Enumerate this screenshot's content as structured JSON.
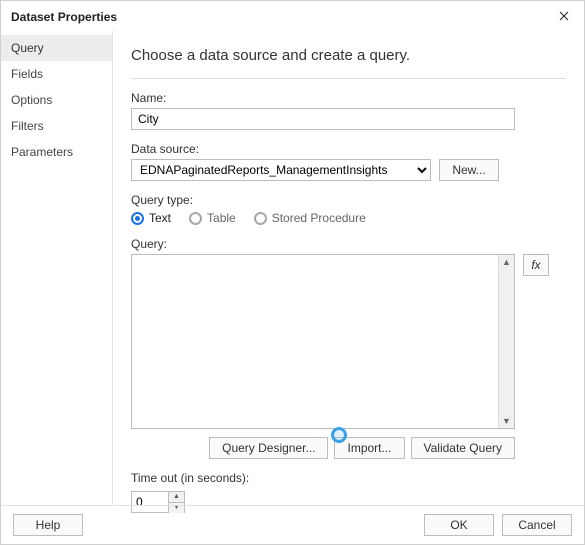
{
  "dialog": {
    "title": "Dataset Properties",
    "close_icon": "close-icon"
  },
  "sidebar": {
    "items": [
      {
        "label": "Query",
        "active": true
      },
      {
        "label": "Fields",
        "active": false
      },
      {
        "label": "Options",
        "active": false
      },
      {
        "label": "Filters",
        "active": false
      },
      {
        "label": "Parameters",
        "active": false
      }
    ]
  },
  "content": {
    "heading": "Choose a data source and create a query.",
    "name_label": "Name:",
    "name_value": "City",
    "datasource_label": "Data source:",
    "datasource_value": "EDNAPaginatedReports_ManagementInsights",
    "new_button": "New...",
    "querytype_label": "Query type:",
    "querytype_options": [
      {
        "label": "Text",
        "checked": true
      },
      {
        "label": "Table",
        "checked": false
      },
      {
        "label": "Stored Procedure",
        "checked": false
      }
    ],
    "query_label": "Query:",
    "query_value": "",
    "fx_label": "fx",
    "buttons": {
      "designer": "Query Designer...",
      "import": "Import...",
      "validate": "Validate Query"
    },
    "timeout_label": "Time out (in seconds):",
    "timeout_value": "0"
  },
  "footer": {
    "help": "Help",
    "ok": "OK",
    "cancel": "Cancel"
  }
}
